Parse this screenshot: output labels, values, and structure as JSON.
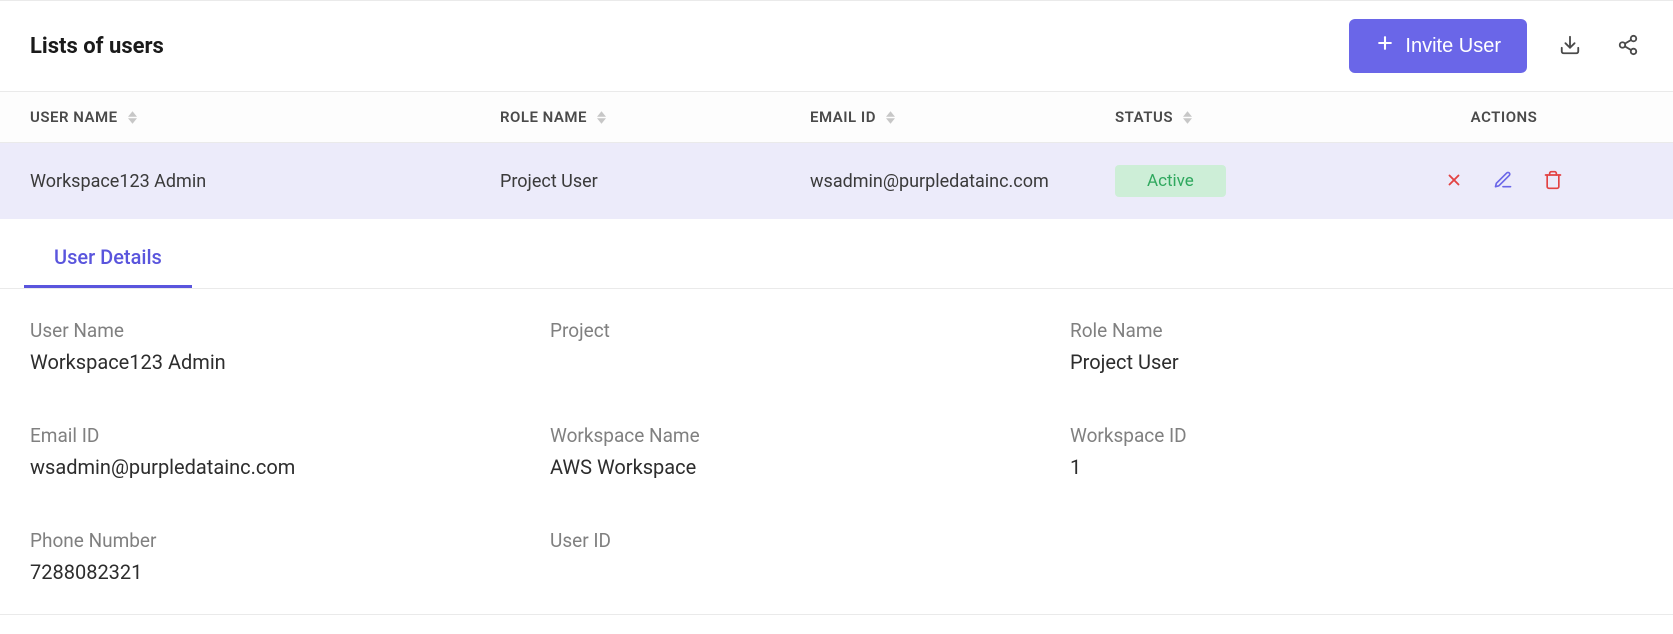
{
  "header": {
    "title": "Lists of users",
    "invite_label": "Invite User"
  },
  "columns": {
    "username": "USER NAME",
    "rolename": "ROLE NAME",
    "email": "EMAIL ID",
    "status": "STATUS",
    "actions": "ACTIONS"
  },
  "row": {
    "username": "Workspace123 Admin",
    "rolename": "Project User",
    "email": "wsadmin@purpledatainc.com",
    "status": "Active"
  },
  "tabs": {
    "user_details": "User Details"
  },
  "details": {
    "username_label": "User Name",
    "username_value": "Workspace123 Admin",
    "project_label": "Project",
    "project_value": "",
    "rolename_label": "Role Name",
    "rolename_value": "Project User",
    "email_label": "Email ID",
    "email_value": "wsadmin@purpledatainc.com",
    "workspace_name_label": "Workspace Name",
    "workspace_name_value": "AWS Workspace",
    "workspace_id_label": "Workspace ID",
    "workspace_id_value": "1",
    "phone_label": "Phone Number",
    "phone_value": "7288082321",
    "userid_label": "User ID",
    "userid_value": ""
  }
}
